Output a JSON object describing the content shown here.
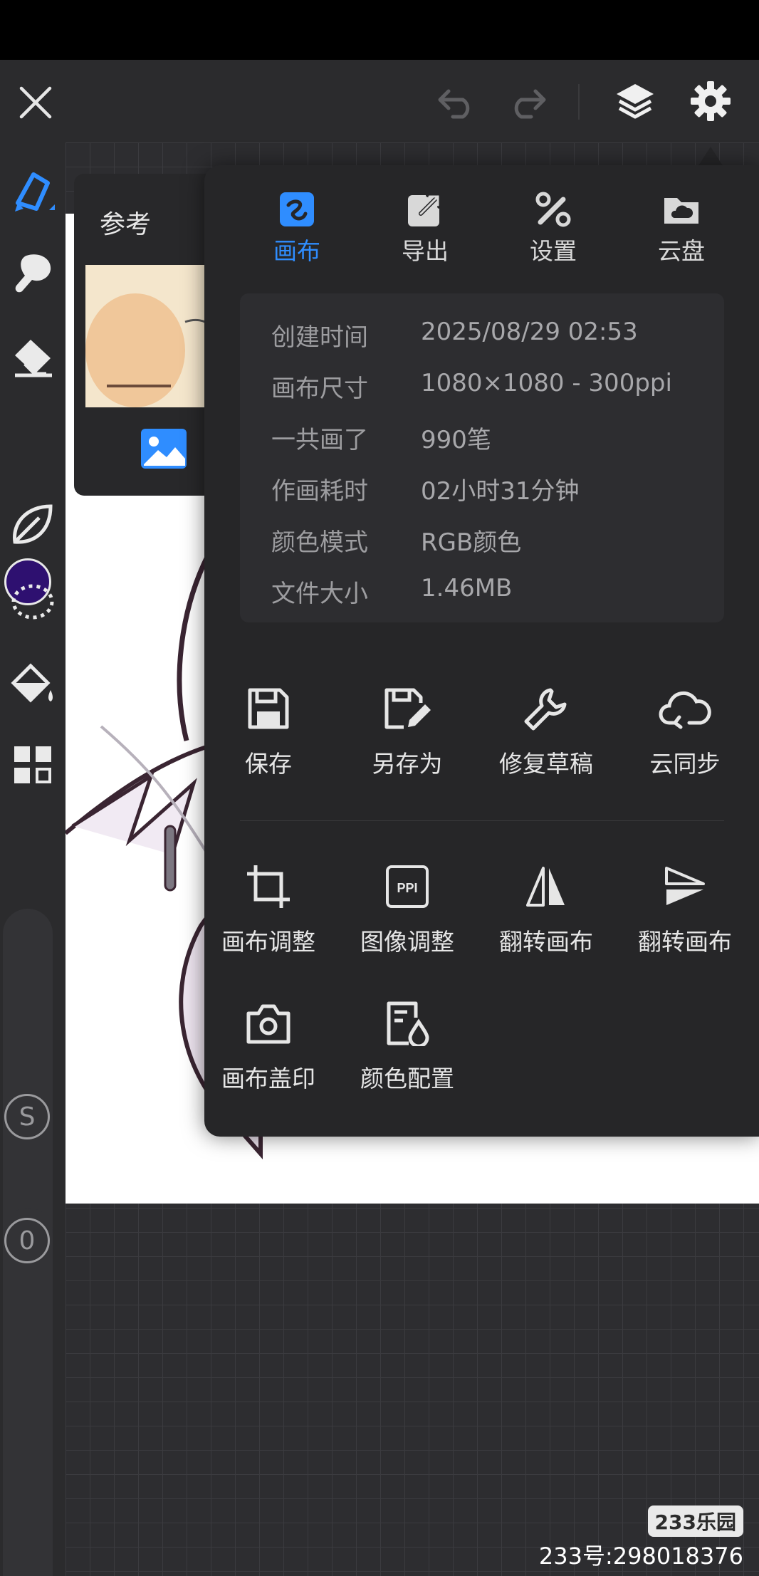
{
  "toolbar": {
    "close": "close-icon",
    "undo": "undo-icon",
    "redo": "redo-icon",
    "layers": "layers-icon",
    "settings": "gear-icon"
  },
  "colors": {
    "accent": "#2f8dff",
    "panel_bg": "#262628",
    "current_color": "#2e1070"
  },
  "rail": {
    "tools": [
      "brush-icon",
      "smudge-icon",
      "eraser-icon",
      "color-swatch",
      "leaf-icon",
      "lasso-icon",
      "fill-icon",
      "grid-icon"
    ],
    "size_knob": "S",
    "opacity_knob": "0"
  },
  "reference": {
    "title": "参考"
  },
  "panel": {
    "tabs": [
      {
        "label": "画布",
        "icon": "canvas-icon",
        "active": true
      },
      {
        "label": "导出",
        "icon": "export-icon",
        "active": false
      },
      {
        "label": "设置",
        "icon": "tools-icon",
        "active": false
      },
      {
        "label": "云盘",
        "icon": "cloud-drive-icon",
        "active": false
      }
    ],
    "info": [
      {
        "key": "创建时间",
        "value": "2025/08/29 02:53"
      },
      {
        "key": "画布尺寸",
        "value": "1080×1080 - 300ppi"
      },
      {
        "key": "一共画了",
        "value": "990笔"
      },
      {
        "key": "作画耗时",
        "value": "02小时31分钟"
      },
      {
        "key": "颜色模式",
        "value": "RGB颜色"
      },
      {
        "key": "文件大小",
        "value": "1.46MB"
      }
    ],
    "actions_row1": [
      {
        "label": "保存",
        "icon": "save-icon"
      },
      {
        "label": "另存为",
        "icon": "save-as-icon"
      },
      {
        "label": "修复草稿",
        "icon": "wrench-icon"
      },
      {
        "label": "云同步",
        "icon": "cloud-sync-icon"
      }
    ],
    "actions_row2": [
      {
        "label": "画布调整",
        "icon": "crop-icon"
      },
      {
        "label": "图像调整",
        "icon": "ppi-icon",
        "icon_text": "PPI"
      },
      {
        "label": "翻转画布",
        "icon": "flip-horizontal-icon"
      },
      {
        "label": "翻转画布",
        "icon": "flip-vertical-icon"
      }
    ],
    "actions_row3": [
      {
        "label": "画布盖印",
        "icon": "camera-icon"
      },
      {
        "label": "颜色配置",
        "icon": "color-profile-icon"
      }
    ]
  },
  "watermark": {
    "brand": "233乐园",
    "uid": "233号:298018376"
  }
}
